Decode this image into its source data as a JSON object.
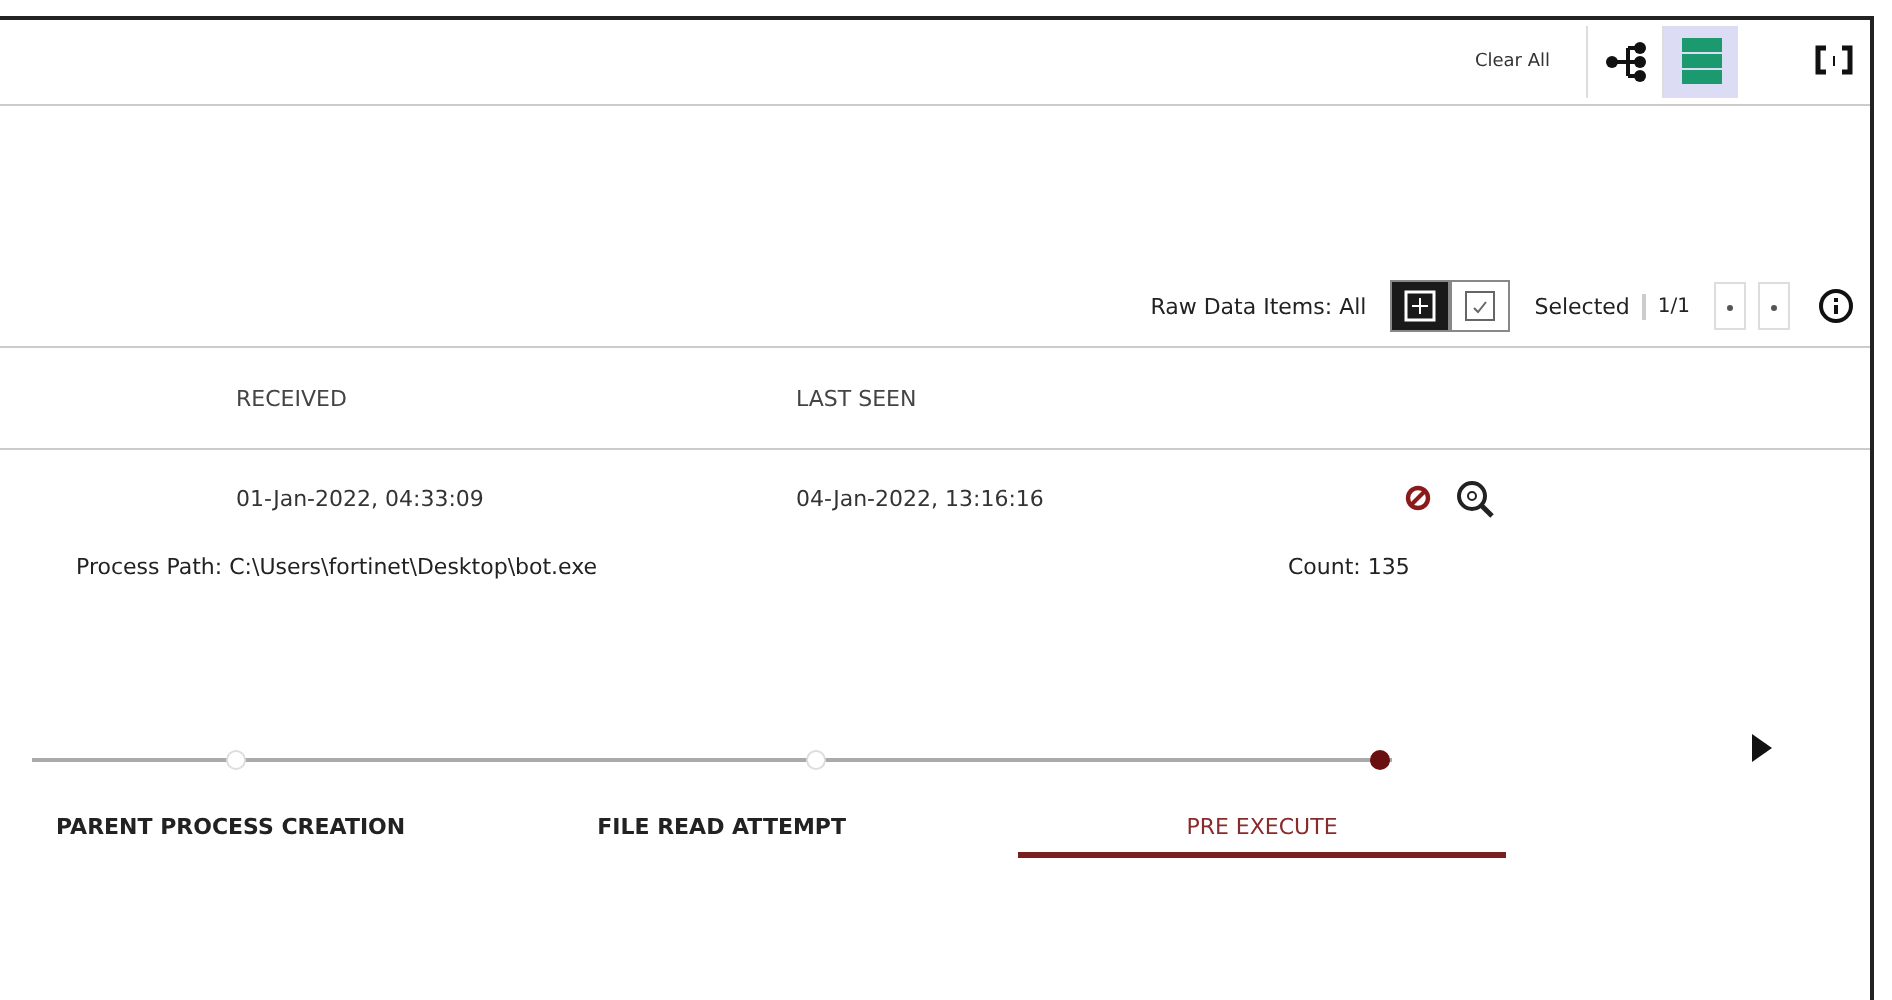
{
  "toolbar": {
    "clear_all": "Clear All",
    "views": [
      {
        "kind": "tree",
        "selected": false
      },
      {
        "kind": "list",
        "selected": true
      }
    ]
  },
  "raw_data": {
    "label": "Raw Data Items: All",
    "modes": [
      {
        "kind": "grid",
        "selected": true
      },
      {
        "kind": "check",
        "selected": false
      }
    ],
    "selected_label": "Selected",
    "page": "1/1"
  },
  "table": {
    "columns": [
      "RECEIVED",
      "LAST SEEN"
    ],
    "rows": [
      {
        "received": "01-Jan-2022, 04:33:09",
        "last_seen": "04-Jan-2022, 13:16:16"
      }
    ]
  },
  "details": {
    "process_path_label": "Process Path:",
    "process_path": "C:\\Users\\fortinet\\Desktop\\bot.exe",
    "count": "Count: 135"
  },
  "timeline": [
    {
      "label": "PARENT PROCESS CREATION",
      "selected": false
    },
    {
      "label": "FILE READ ATTEMPT",
      "selected": false
    },
    {
      "label": "PRE EXECUTE",
      "selected": true
    }
  ]
}
